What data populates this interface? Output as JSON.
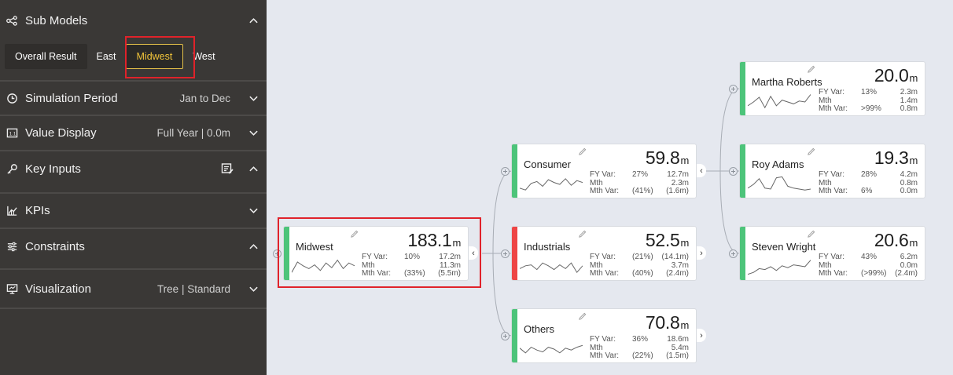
{
  "sidebar": {
    "sub_models": {
      "title": "Sub Models",
      "tabs": [
        "Overall Result",
        "East",
        "Midwest",
        "West"
      ],
      "active_tab": "Midwest"
    },
    "simulation_period": {
      "title": "Simulation Period",
      "value": "Jan to Dec"
    },
    "value_display": {
      "title": "Value Display",
      "value": "Full Year | 0.0m"
    },
    "key_inputs": {
      "title": "Key Inputs"
    },
    "kpis": {
      "title": "KPIs"
    },
    "constraints": {
      "title": "Constraints"
    },
    "visualization": {
      "title": "Visualization",
      "value": "Tree | Standard"
    }
  },
  "tree": {
    "labels": {
      "fy_var": "FY Var:",
      "mth": "Mth",
      "mth_var": "Mth Var:"
    },
    "unit": "m",
    "colors": {
      "positive": "#4dc47a",
      "negative": "#ee4545"
    },
    "nodes": [
      {
        "id": "midwest",
        "name": "Midwest",
        "value": "183.1",
        "status": "positive",
        "fy_var_pct": "10%",
        "fy_var_abs": "17.2m",
        "mth": "11.3m",
        "mth_var_pct": "(33%)",
        "mth_var_abs": "(5.5m)",
        "toggle": "‹"
      },
      {
        "id": "consumer",
        "name": "Consumer",
        "value": "59.8",
        "status": "positive",
        "fy_var_pct": "27%",
        "fy_var_abs": "12.7m",
        "mth": "2.3m",
        "mth_var_pct": "(41%)",
        "mth_var_abs": "(1.6m)",
        "toggle": "‹"
      },
      {
        "id": "industrials",
        "name": "Industrials",
        "value": "52.5",
        "status": "negative",
        "fy_var_pct": "(21%)",
        "fy_var_abs": "(14.1m)",
        "mth": "3.7m",
        "mth_var_pct": "(40%)",
        "mth_var_abs": "(2.4m)",
        "toggle": "›"
      },
      {
        "id": "others",
        "name": "Others",
        "value": "70.8",
        "status": "positive",
        "fy_var_pct": "36%",
        "fy_var_abs": "18.6m",
        "mth": "5.4m",
        "mth_var_pct": "(22%)",
        "mth_var_abs": "(1.5m)",
        "toggle": "›"
      },
      {
        "id": "martha",
        "name": "Martha Roberts",
        "value": "20.0",
        "status": "positive",
        "fy_var_pct": "13%",
        "fy_var_abs": "2.3m",
        "mth": "1.4m",
        "mth_var_pct": ">99%",
        "mth_var_abs": "0.8m",
        "toggle": ""
      },
      {
        "id": "roy",
        "name": "Roy Adams",
        "value": "19.3",
        "status": "positive",
        "fy_var_pct": "28%",
        "fy_var_abs": "4.2m",
        "mth": "0.8m",
        "mth_var_pct": "6%",
        "mth_var_abs": "0.0m",
        "toggle": ""
      },
      {
        "id": "steven",
        "name": "Steven Wright",
        "value": "20.6",
        "status": "positive",
        "fy_var_pct": "43%",
        "fy_var_abs": "6.2m",
        "mth": "0.0m",
        "mth_var_pct": "(>99%)",
        "mth_var_abs": "(2.4m)",
        "toggle": ""
      }
    ]
  }
}
